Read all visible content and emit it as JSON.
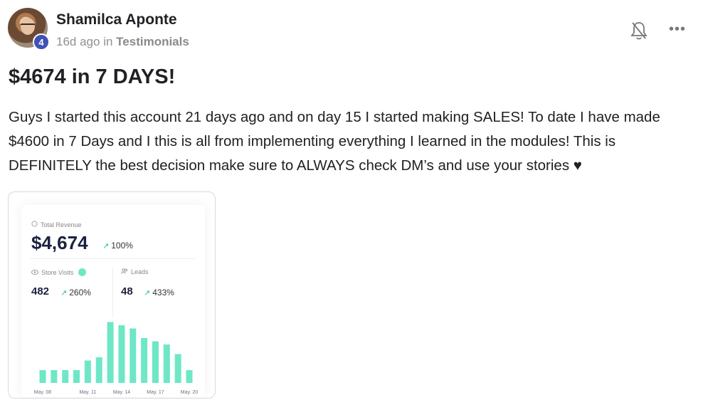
{
  "post": {
    "author": "Shamilca Aponte",
    "level": "4",
    "time": "16d ago",
    "in_word": "in",
    "category": "Testimonials",
    "title": "$4674 in 7 DAYS!",
    "body": "Guys I started this account 21 days ago and on day 15 I started making SALES! To date I have made $4600 in 7 Days and I this is all from implementing everything I learned in the modules! This is DEFINITELY the best decision make sure to ALWAYS check DM’s and use your stories ♥"
  },
  "header_actions": {
    "more_label": "•••"
  },
  "stats": {
    "revenue_label": "Total Revenue",
    "revenue_value": "$4,674",
    "revenue_change": "100%",
    "visits_label": "Store Visits",
    "visits_value": "482",
    "visits_change": "260%",
    "leads_label": "Leads",
    "leads_value": "48",
    "leads_change": "433%"
  },
  "colors": {
    "bar": "#6ee7c7",
    "badge": "#3f51b5"
  },
  "chart_data": {
    "type": "bar",
    "categories": [
      "May. 08",
      "",
      "",
      "",
      "May. 11",
      "",
      "",
      "May. 14",
      "",
      "",
      "May. 17",
      "",
      "",
      "May. 20"
    ],
    "values": [
      4,
      4,
      4,
      4,
      7,
      8,
      19,
      18,
      17,
      14,
      13,
      12,
      9,
      4
    ],
    "tick_labels": [
      "May. 08",
      "May. 11",
      "May. 14",
      "May. 17",
      "May. 20"
    ],
    "ylim": [
      0,
      20
    ]
  }
}
